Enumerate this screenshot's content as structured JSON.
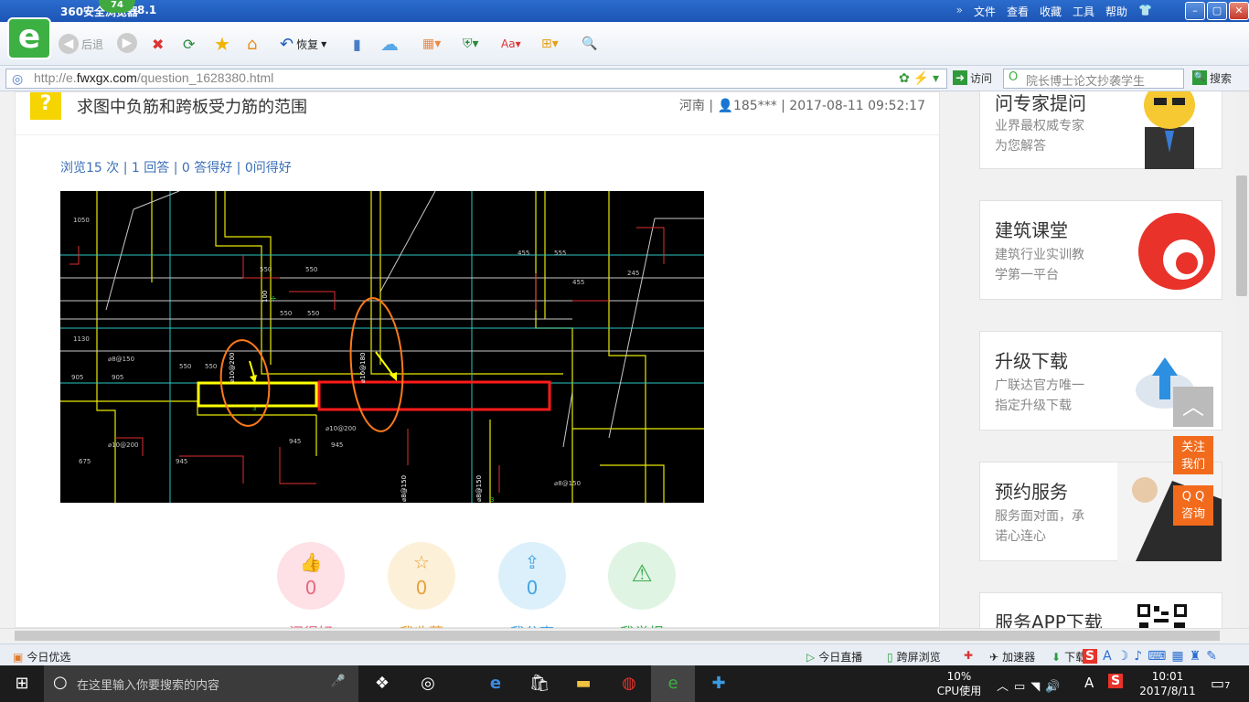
{
  "browser": {
    "title": "360安全浏览器",
    "version": "8.1",
    "badge": "74",
    "menu": [
      "文件",
      "查看",
      "收藏",
      "工具",
      "帮助"
    ],
    "window_buttons": [
      "–",
      "▢",
      "✕"
    ]
  },
  "toolbar": {
    "back": "后退",
    "restore": "恢复"
  },
  "address": {
    "prefix": "http://e.",
    "host": "fwxgx.com",
    "path": "/question_1628380.html",
    "go": "访问",
    "search_placeholder": "院长博士论文抄袭学生",
    "search_btn": "搜索"
  },
  "question": {
    "icon": "?",
    "title": "求图中负筋和跨板受力筋的范围",
    "meta": "河南 | 👤185*** | 2017-08-11 09:52:17",
    "stats": "浏览15 次 | 1 回答 | 0 答得好 | 0问得好"
  },
  "actions": [
    {
      "icon": "👍",
      "count": "0",
      "label": "问得好",
      "bg": "#fde1e6",
      "fg": "#e8687d"
    },
    {
      "icon": "☆",
      "count": "0",
      "label": "我收藏",
      "bg": "#fdf0d8",
      "fg": "#e6a23c"
    },
    {
      "icon": "⇪",
      "count": "0",
      "label": "我分享",
      "bg": "#dcf0fb",
      "fg": "#42a5e0"
    },
    {
      "icon": "⚠",
      "count": "",
      "label": "我举报",
      "bg": "#e0f4e3",
      "fg": "#3fae52"
    }
  ],
  "sidebar": [
    {
      "h": "问专家提问",
      "d1": "业界最权威专家",
      "d2": "为您解答"
    },
    {
      "h": "建筑课堂",
      "d1": "建筑行业实训教",
      "d2": "学第一平台"
    },
    {
      "h": "升级下载",
      "d1": "广联达官方唯一",
      "d2": "指定升级下载"
    },
    {
      "h": "预约服务",
      "d1": "服务面对面，承",
      "d2": "诺心连心"
    },
    {
      "h": "服务APP下载",
      "d1": "",
      "d2": ""
    }
  ],
  "float": {
    "follow1": "关注",
    "follow2": "我们",
    "qq1": "Q Q",
    "qq2": "咨询",
    "totop": "︿"
  },
  "status": {
    "today": "今日优选",
    "live": "今日直播",
    "cross": "跨屏浏览",
    "accel": "加速器",
    "download": "下载"
  },
  "taskbar": {
    "search_placeholder": "在这里输入你要搜索的内容",
    "cpu_pct": "10%",
    "cpu_label": "CPU使用",
    "time": "10:01",
    "date": "2017/8/11",
    "notif": "7",
    "ime": "A"
  }
}
